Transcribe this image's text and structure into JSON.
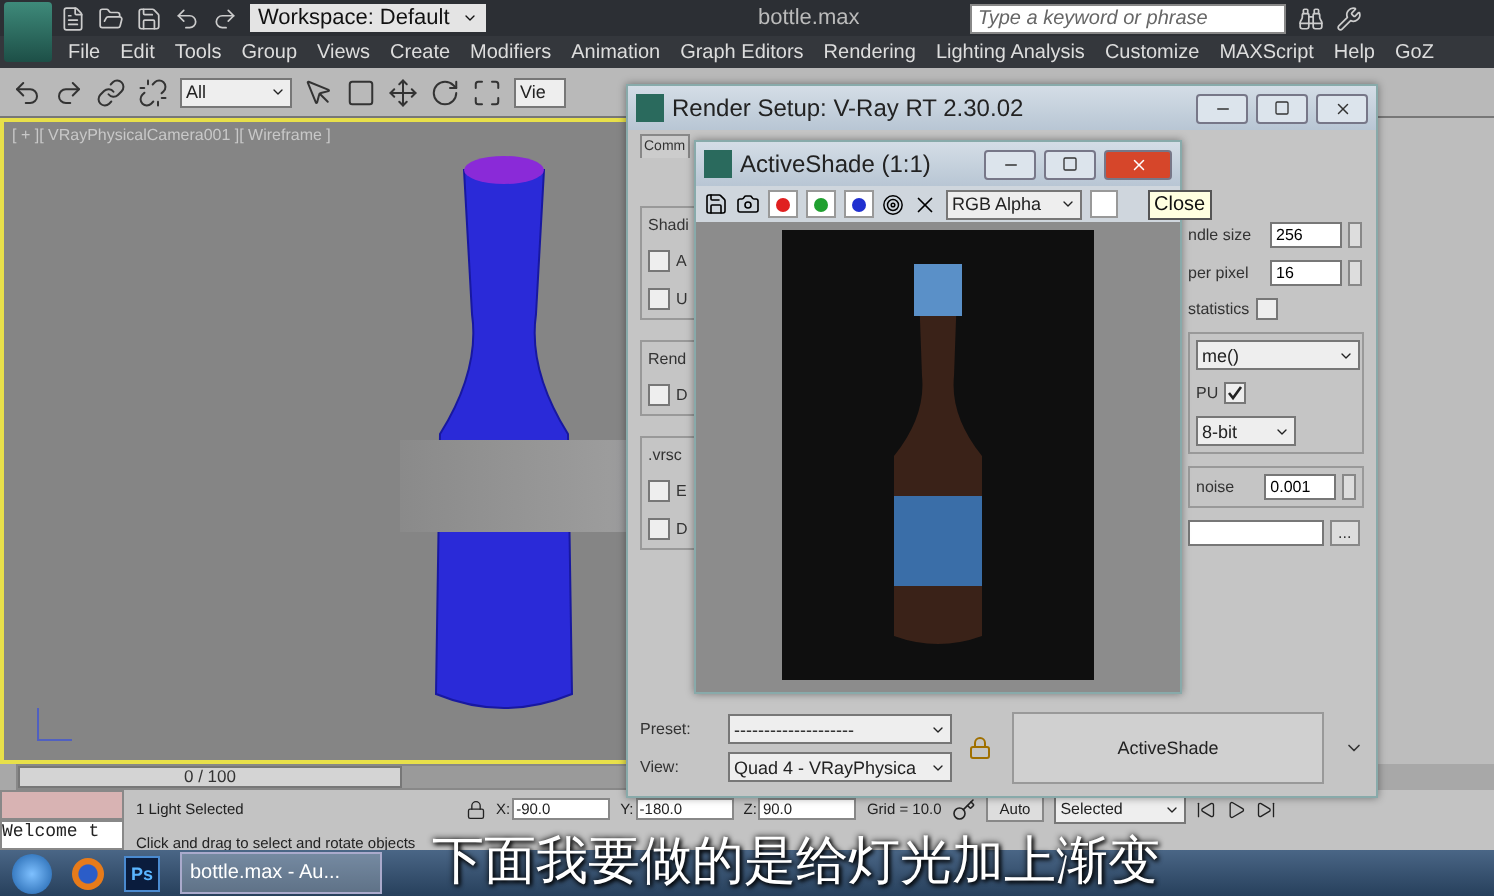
{
  "app": {
    "title": "bottle.max",
    "workspace": "Workspace: Default",
    "search": {
      "placeholder": "Type a keyword or phrase"
    }
  },
  "menu": [
    "File",
    "Edit",
    "Tools",
    "Group",
    "Views",
    "Create",
    "Modifiers",
    "Animation",
    "Graph Editors",
    "Rendering",
    "Lighting Analysis",
    "Customize",
    "MAXScript",
    "Help",
    "GoZ"
  ],
  "toolbar": {
    "selection_filter": "All",
    "view": "Vie"
  },
  "viewport": {
    "label": "[ + ][ VRayPhysicalCamera001 ][ Wireframe ]",
    "active": true
  },
  "timeline": {
    "position": "0 / 100"
  },
  "status": {
    "listener": "Welcome t",
    "selection": "1 Light Selected",
    "prompt": "Click and drag to select and rotate objects",
    "coords": [
      {
        "axis": "X:",
        "value": "-90.0"
      },
      {
        "axis": "Y:",
        "value": "-180.0"
      },
      {
        "axis": "Z:",
        "value": "90.0"
      }
    ],
    "grid": "Grid = 10.0",
    "auto_key": "Auto",
    "key_filter": "Selected"
  },
  "taskbar": {
    "items": [
      {
        "kind": "browser"
      },
      {
        "kind": "app",
        "label": "Ps"
      },
      {
        "kind": "window",
        "label": "bottle.max - Au..."
      }
    ]
  },
  "render_setup": {
    "title": "Render Setup: V-Ray RT 2.30.02",
    "tab": "Comm",
    "left_groups": [
      {
        "label": "Shadi",
        "checkboxes": [
          {
            "label": "A",
            "checked": false
          },
          {
            "label": "U",
            "checked": false
          }
        ]
      },
      {
        "label": "Rend",
        "checkboxes": [
          {
            "label": "D",
            "checked": false
          }
        ]
      },
      {
        "label": ".vrsc",
        "checkboxes": [
          {
            "label": "E",
            "checked": false
          },
          {
            "label": "D",
            "checked": false
          }
        ]
      }
    ],
    "bundle_size": {
      "label": "ndle size",
      "value": "256"
    },
    "per_pixel": {
      "label": "per pixel",
      "value": "16"
    },
    "statistics": {
      "label": "statistics",
      "checked": false
    },
    "device": "me()",
    "gpu": {
      "label": "PU",
      "checked": true
    },
    "bit_depth": "8-bit",
    "noise": {
      "label": "noise",
      "value": "0.001"
    },
    "browse": "...",
    "preset": {
      "label": "Preset:",
      "value": "--------------------"
    },
    "view": {
      "label": "View:",
      "value": "Quad 4 - VRayPhysica"
    },
    "render_button": "ActiveShade"
  },
  "activeshade": {
    "title": "ActiveShade (1:1)",
    "channels": [
      {
        "color": "#e02020",
        "on": true
      },
      {
        "color": "#20a030",
        "on": true
      },
      {
        "color": "#2030d0",
        "on": true
      }
    ],
    "display": "RGB Alpha",
    "tooltip": "Close"
  },
  "subtitle": "下面我要做的是给灯光加上渐变"
}
